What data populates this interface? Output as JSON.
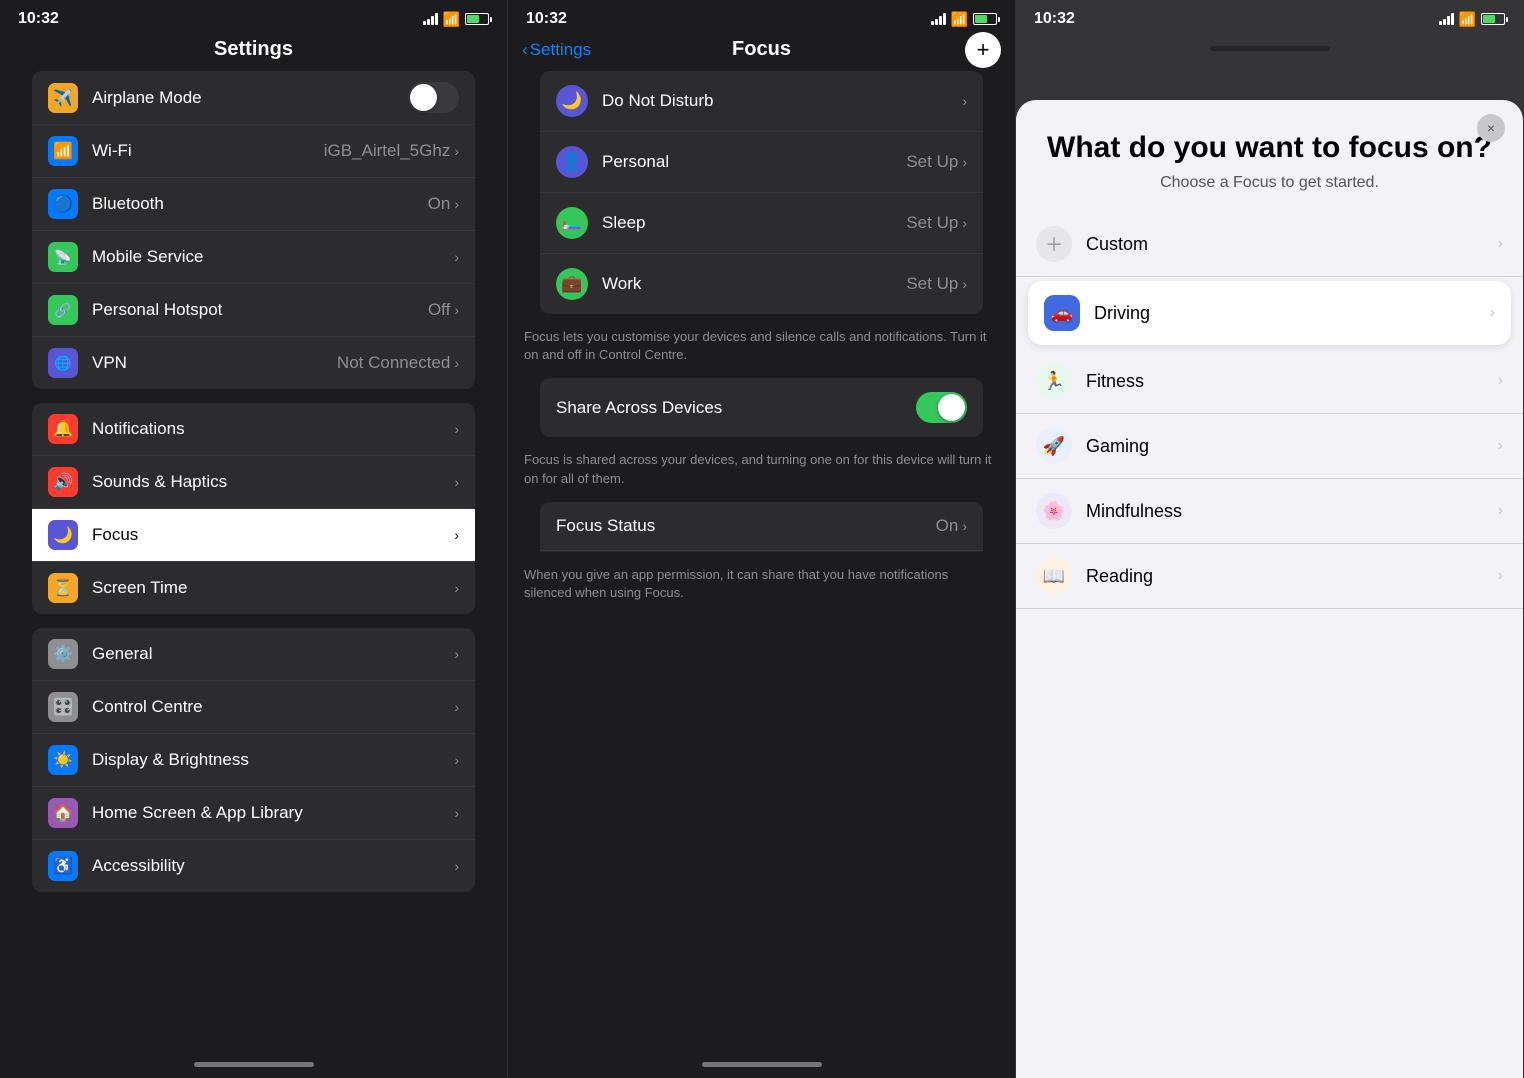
{
  "panel1": {
    "time": "10:32",
    "title": "Settings",
    "items_group1": [
      {
        "id": "airplane-mode",
        "label": "Airplane Mode",
        "value": "",
        "icon_bg": "#f5a623",
        "icon": "✈️",
        "has_toggle": true
      },
      {
        "id": "wifi",
        "label": "Wi-Fi",
        "value": "iGB_Airtel_5Ghz",
        "icon_bg": "#007aff",
        "icon": "📶"
      },
      {
        "id": "bluetooth",
        "label": "Bluetooth",
        "value": "On",
        "icon_bg": "#007aff",
        "icon": "🔷"
      },
      {
        "id": "mobile-service",
        "label": "Mobile Service",
        "value": "",
        "icon_bg": "#34c759",
        "icon": "📡"
      },
      {
        "id": "personal-hotspot",
        "label": "Personal Hotspot",
        "value": "Off",
        "icon_bg": "#34c759",
        "icon": "🔗"
      },
      {
        "id": "vpn",
        "label": "VPN",
        "value": "Not Connected",
        "icon_bg": "#5856d6",
        "icon": "🌐"
      }
    ],
    "items_group2": [
      {
        "id": "notifications",
        "label": "Notifications",
        "value": "",
        "icon_bg": "#ff3b30",
        "icon": "🔔"
      },
      {
        "id": "sounds-haptics",
        "label": "Sounds & Haptics",
        "value": "",
        "icon_bg": "#ff3b30",
        "icon": "🔊"
      },
      {
        "id": "focus",
        "label": "Focus",
        "value": "",
        "icon_bg": "#5856d6",
        "icon": "🌙",
        "highlighted": true
      },
      {
        "id": "screen-time",
        "label": "Screen Time",
        "value": "",
        "icon_bg": "#f5a623",
        "icon": "⏳"
      }
    ],
    "items_group3": [
      {
        "id": "general",
        "label": "General",
        "value": "",
        "icon_bg": "#8e8e93",
        "icon": "⚙️"
      },
      {
        "id": "control-centre",
        "label": "Control Centre",
        "value": "",
        "icon_bg": "#8e8e93",
        "icon": "🎛️"
      },
      {
        "id": "display-brightness",
        "label": "Display & Brightness",
        "value": "",
        "icon_bg": "#007aff",
        "icon": "☀️"
      },
      {
        "id": "home-screen",
        "label": "Home Screen & App Library",
        "value": "",
        "icon_bg": "#9b59b6",
        "icon": "🏠"
      },
      {
        "id": "accessibility",
        "label": "Accessibility",
        "value": "",
        "icon_bg": "#007aff",
        "icon": "♿"
      }
    ]
  },
  "panel2": {
    "time": "10:32",
    "back_label": "Settings",
    "title": "Focus",
    "plus_label": "+",
    "items": [
      {
        "id": "do-not-disturb",
        "label": "Do Not Disturb",
        "value": "",
        "icon": "🌙",
        "icon_bg": "#5856d6"
      },
      {
        "id": "personal",
        "label": "Personal",
        "value": "Set Up",
        "icon": "👤",
        "icon_bg": "#5856d6"
      },
      {
        "id": "sleep",
        "label": "Sleep",
        "value": "Set Up",
        "icon": "🛏️",
        "icon_bg": "#34c759"
      },
      {
        "id": "work",
        "label": "Work",
        "value": "Set Up",
        "icon": "💼",
        "icon_bg": "#34c759"
      }
    ],
    "description1": "Focus lets you customise your devices and silence calls and notifications. Turn it on and off in Control Centre.",
    "share_label": "Share Across Devices",
    "share_value": "On",
    "description2": "Focus is shared across your devices, and turning one on for this device will turn it on for all of them.",
    "focus_status_label": "Focus Status",
    "focus_status_value": "On",
    "description3": "When you give an app permission, it can share that you have notifications silenced when using Focus."
  },
  "panel3": {
    "time": "10:32",
    "close_label": "×",
    "modal_title": "What do you want to focus on?",
    "modal_subtitle": "Choose a Focus to get started.",
    "options": [
      {
        "id": "custom",
        "label": "Custom",
        "icon": "➕",
        "icon_bg": "#8e8e93",
        "highlighted": false
      },
      {
        "id": "driving",
        "label": "Driving",
        "icon": "🚗",
        "icon_bg": "#4169e1",
        "highlighted": true
      },
      {
        "id": "fitness",
        "label": "Fitness",
        "icon": "🏃",
        "icon_bg": "#34c759",
        "highlighted": false
      },
      {
        "id": "gaming",
        "label": "Gaming",
        "icon": "🚀",
        "icon_bg": "#007aff",
        "highlighted": false
      },
      {
        "id": "mindfulness",
        "label": "Mindfulness",
        "icon": "🌸",
        "icon_bg": "#5856d6",
        "highlighted": false
      },
      {
        "id": "reading",
        "label": "Reading",
        "icon": "📖",
        "icon_bg": "#f5a623",
        "highlighted": false
      }
    ]
  }
}
